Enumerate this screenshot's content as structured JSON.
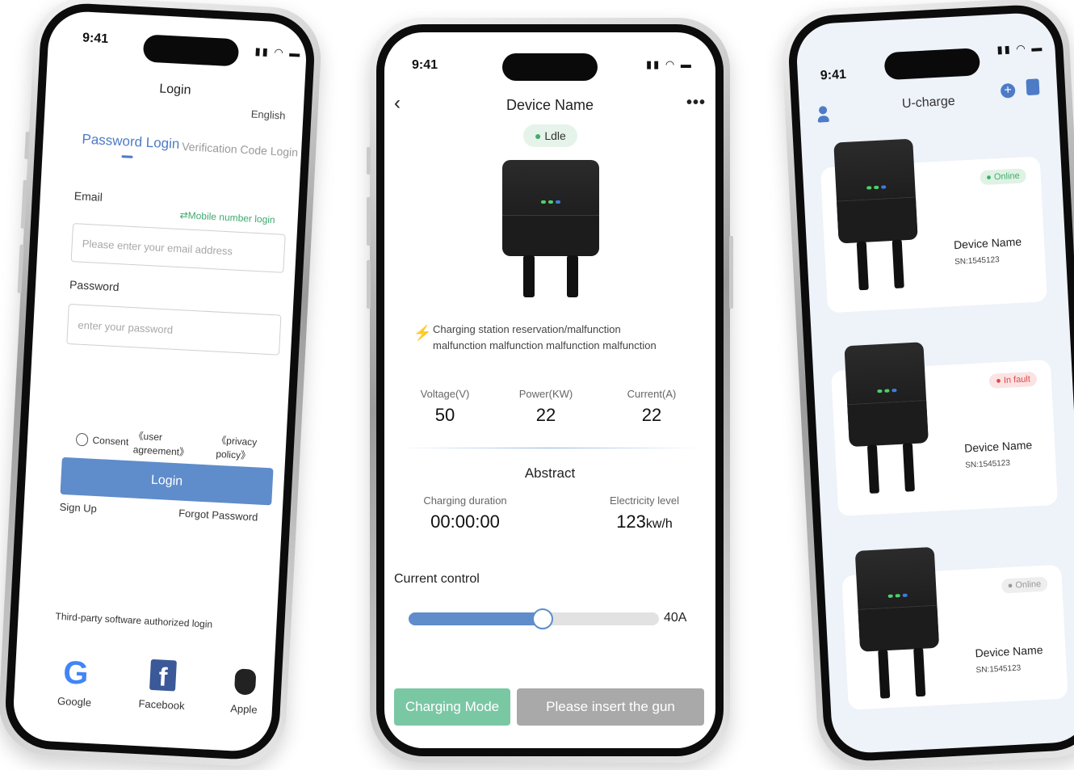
{
  "phone1": {
    "time": "9:41",
    "title": "Login",
    "language": "English",
    "tabs": [
      "Password Login",
      "Verification Code Login"
    ],
    "email_label": "Email",
    "mobile_login": "Mobile number login",
    "email_placeholder": "Please enter your email address",
    "password_label": "Password",
    "password_placeholder": "enter your password",
    "consent": "Consent",
    "user_agreement": "《user agreement》",
    "privacy_policy": "《privacy policy》",
    "login_button": "Login",
    "sign_up": "Sign Up",
    "forgot_password": "Forgot Password",
    "third_party": "Third-party software authorized login",
    "social": [
      {
        "label": "Google",
        "icon": "google-icon"
      },
      {
        "label": "Facebook",
        "icon": "facebook-icon"
      },
      {
        "label": "Apple",
        "icon": "apple-icon"
      }
    ]
  },
  "phone2": {
    "time": "9:41",
    "title": "Device Name",
    "status": "Ldle",
    "notice_line1": "Charging station reservation/malfunction",
    "notice_line2": "malfunction malfunction malfunction malfunction",
    "metrics": [
      {
        "label": "Voltage(V)",
        "value": "50"
      },
      {
        "label": "Power(KW)",
        "value": "22"
      },
      {
        "label": "Current(A)",
        "value": "22"
      }
    ],
    "abstract_title": "Abstract",
    "charging_duration_label": "Charging duration",
    "charging_duration": "00:00:00",
    "electricity_label": "Electricity level",
    "electricity_value": "123",
    "electricity_unit": "kw/h",
    "current_control_label": "Current control",
    "slider_fraction": 0.53,
    "slider_value": "40A",
    "charging_mode_button": "Charging Mode",
    "insert_gun_button": "Please insert the gun",
    "colors": {
      "green": "#7ac7a4",
      "slider": "#5f8ccb"
    }
  },
  "phone3": {
    "time": "9:41",
    "title": "U-charge",
    "devices": [
      {
        "name": "Device Name",
        "sn": "SN:1545123",
        "status": "Online",
        "status_type": "online"
      },
      {
        "name": "Device Name",
        "sn": "SN:1545123",
        "status": "In fault",
        "status_type": "fault"
      },
      {
        "name": "Device Name",
        "sn": "SN:1545123",
        "status": "Online",
        "status_type": "offline"
      }
    ]
  }
}
